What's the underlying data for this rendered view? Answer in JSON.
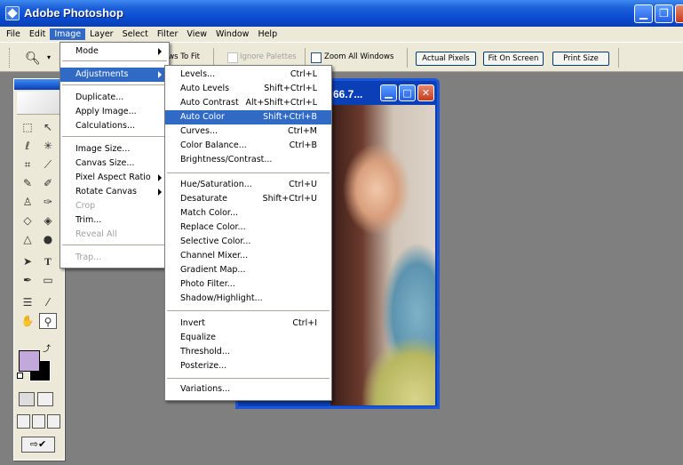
{
  "app": {
    "title": "Adobe Photoshop"
  },
  "menubar": [
    "File",
    "Edit",
    "Image",
    "Layer",
    "Select",
    "Filter",
    "View",
    "Window",
    "Help"
  ],
  "options_bar": {
    "windows_to_fit_partial": "ows To Fit",
    "ignore_palettes": "Ignore Palettes",
    "zoom_all_windows": "Zoom All Windows",
    "actual_pixels": "Actual Pixels",
    "fit_on_screen": "Fit On Screen",
    "print_size": "Print Size"
  },
  "document": {
    "title_partial": "66.7..."
  },
  "image_menu": {
    "items": [
      {
        "label": "Mode",
        "submenu": true
      },
      {
        "label": "Adjustments",
        "submenu": true,
        "highlighted": true
      },
      {
        "label": "Duplicate..."
      },
      {
        "label": "Apply Image..."
      },
      {
        "label": "Calculations..."
      },
      {
        "label": "Image Size..."
      },
      {
        "label": "Canvas Size..."
      },
      {
        "label": "Pixel Aspect Ratio",
        "submenu": true
      },
      {
        "label": "Rotate Canvas",
        "submenu": true
      },
      {
        "label": "Crop",
        "disabled": true
      },
      {
        "label": "Trim..."
      },
      {
        "label": "Reveal All",
        "disabled": true
      },
      {
        "label": "Trap...",
        "disabled": true
      }
    ]
  },
  "adjustments_menu": {
    "items": [
      {
        "label": "Levels...",
        "shortcut": "Ctrl+L"
      },
      {
        "label": "Auto Levels",
        "shortcut": "Shift+Ctrl+L"
      },
      {
        "label": "Auto Contrast",
        "shortcut": "Alt+Shift+Ctrl+L"
      },
      {
        "label": "Auto Color",
        "shortcut": "Shift+Ctrl+B",
        "highlighted": true
      },
      {
        "label": "Curves...",
        "shortcut": "Ctrl+M"
      },
      {
        "label": "Color Balance...",
        "shortcut": "Ctrl+B"
      },
      {
        "label": "Brightness/Contrast...",
        "shortcut": ""
      },
      {
        "label": "Hue/Saturation...",
        "shortcut": "Ctrl+U"
      },
      {
        "label": "Desaturate",
        "shortcut": "Shift+Ctrl+U"
      },
      {
        "label": "Match Color...",
        "shortcut": ""
      },
      {
        "label": "Replace Color...",
        "shortcut": ""
      },
      {
        "label": "Selective Color...",
        "shortcut": ""
      },
      {
        "label": "Channel Mixer...",
        "shortcut": ""
      },
      {
        "label": "Gradient Map...",
        "shortcut": ""
      },
      {
        "label": "Photo Filter...",
        "shortcut": ""
      },
      {
        "label": "Shadow/Highlight...",
        "shortcut": ""
      },
      {
        "label": "Invert",
        "shortcut": "Ctrl+I"
      },
      {
        "label": "Equalize",
        "shortcut": ""
      },
      {
        "label": "Threshold...",
        "shortcut": ""
      },
      {
        "label": "Posterize...",
        "shortcut": ""
      },
      {
        "label": "Variations...",
        "shortcut": ""
      }
    ]
  },
  "colors": {
    "foreground": "#c3a8dc",
    "background": "#000000",
    "highlight": "#316ac5"
  },
  "icons": [
    "zoom-tool-icon",
    "marquee-tool-icon",
    "move-tool-icon",
    "lasso-tool-icon",
    "magic-wand-icon",
    "crop-tool-icon",
    "slice-tool-icon",
    "healing-brush-icon",
    "brush-tool-icon",
    "clone-stamp-icon",
    "history-brush-icon",
    "eraser-icon",
    "paint-bucket-icon",
    "blur-tool-icon",
    "dodge-tool-icon",
    "path-selection-icon",
    "type-tool-icon",
    "pen-tool-icon",
    "shape-tool-icon",
    "notes-icon",
    "eyedropper-icon",
    "hand-tool-icon",
    "zoom-icon"
  ]
}
